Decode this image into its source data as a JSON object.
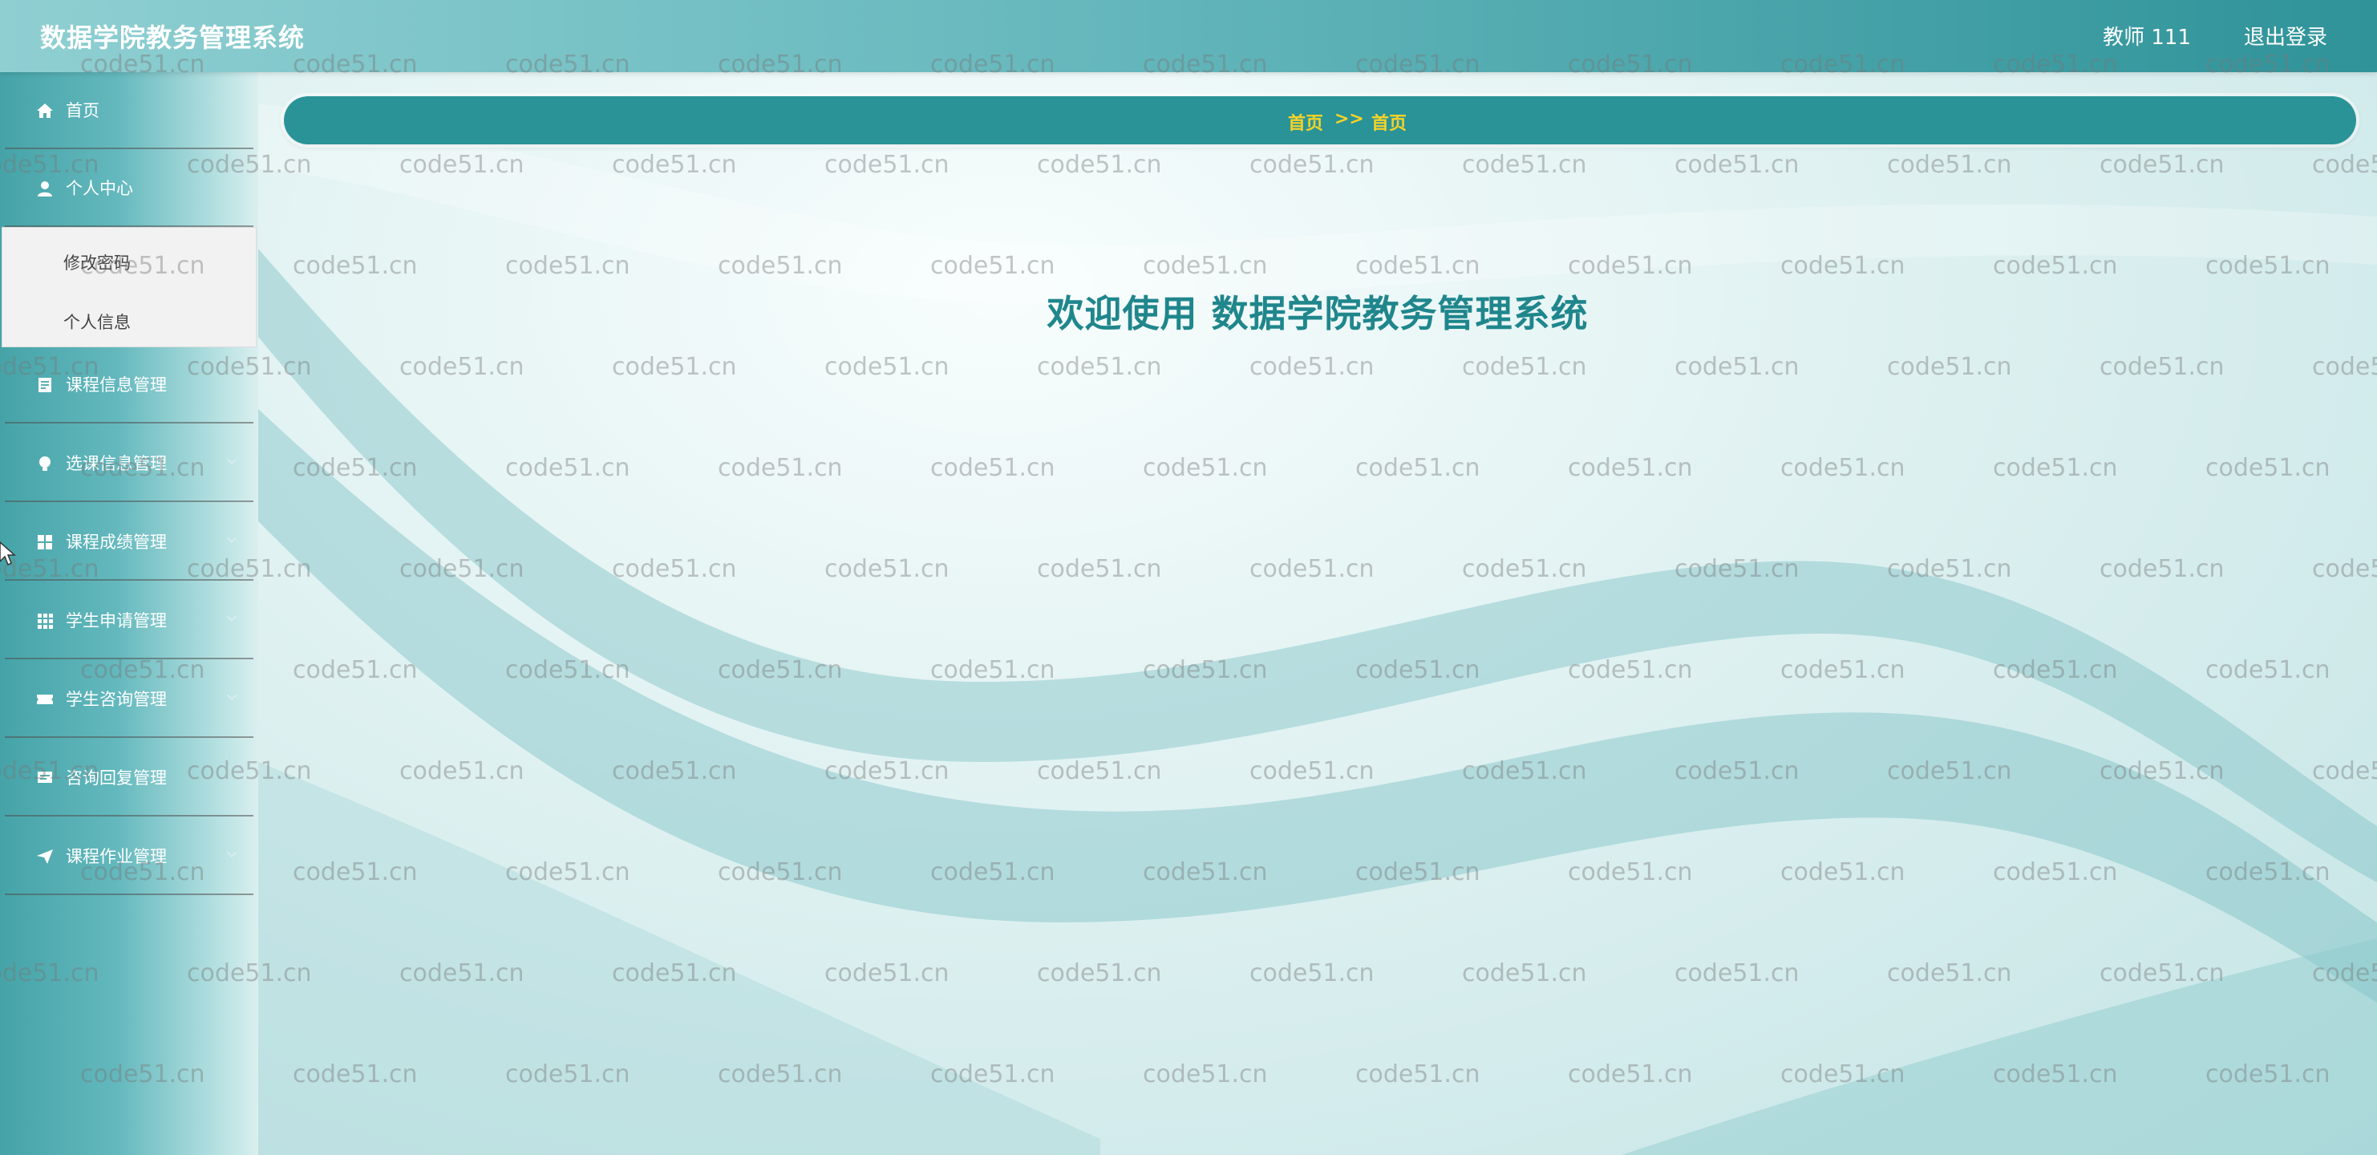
{
  "header": {
    "title": "数据学院教务管理系统",
    "user": "教师 111",
    "logout": "退出登录"
  },
  "sidebar": {
    "items": [
      {
        "label": "首页",
        "icon": "home-icon"
      },
      {
        "label": "个人中心",
        "icon": "user-icon"
      },
      {
        "label": "课程信息管理",
        "icon": "document-icon"
      },
      {
        "label": "选课信息管理",
        "icon": "bulb-icon"
      },
      {
        "label": "课程成绩管理",
        "icon": "grid-icon"
      },
      {
        "label": "学生申请管理",
        "icon": "apps-icon"
      },
      {
        "label": "学生咨询管理",
        "icon": "ticket-icon"
      },
      {
        "label": "咨询回复管理",
        "icon": "reply-icon"
      },
      {
        "label": "课程作业管理",
        "icon": "send-icon"
      }
    ],
    "submenu": {
      "items": [
        "修改密码",
        "个人信息"
      ]
    }
  },
  "breadcrumb": {
    "first": "首页",
    "separator": ">>",
    "second": "首页"
  },
  "main": {
    "welcome": "欢迎使用 数据学院教务管理系统"
  },
  "watermark": "code51.cn",
  "colors": {
    "accent": "#2a9398",
    "breadcrumb_text": "#f5d328",
    "welcome_text": "#1f868c"
  }
}
